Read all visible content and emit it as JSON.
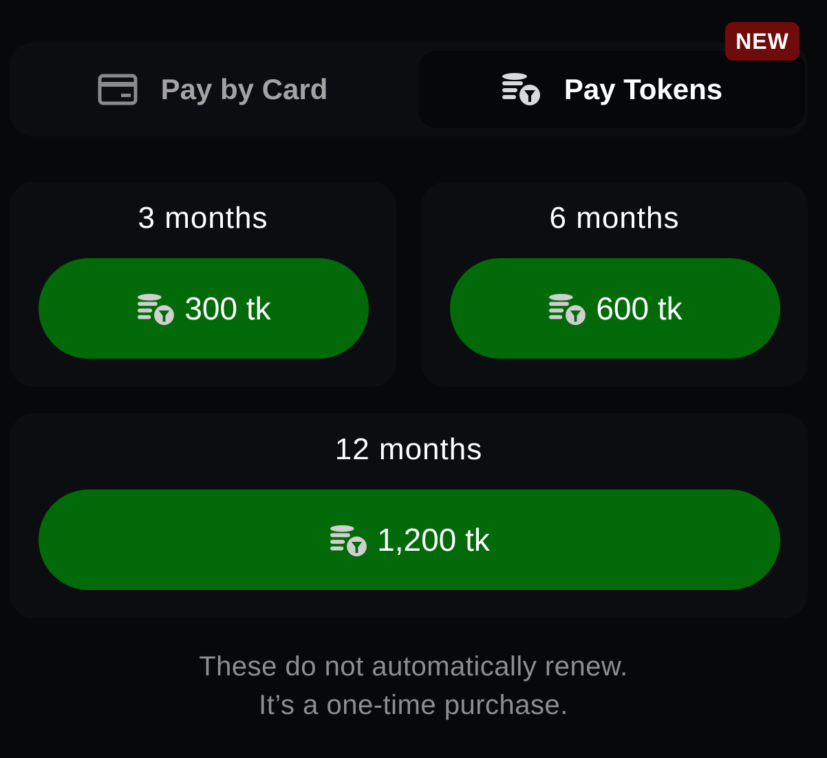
{
  "tabs": {
    "card": {
      "label": "Pay by Card",
      "icon": "credit-card-icon"
    },
    "tokens": {
      "label": "Pay Tokens",
      "icon": "tokens-coin-stack-icon",
      "selected": true
    },
    "badge": "NEW"
  },
  "plans": [
    {
      "title": "3 months",
      "price": "300 tk"
    },
    {
      "title": "6 months",
      "price": "600 tk"
    },
    {
      "title": "12 months",
      "price": "1,200 tk"
    }
  ],
  "footnote": {
    "line1": "These do not automatically renew.",
    "line2": "It’s a one-time purchase."
  },
  "colors": {
    "background": "#07080a",
    "card": "#0c0d10",
    "button_green": "#026a09",
    "badge_red": "#700b0b",
    "muted_text": "#8e8e8e"
  }
}
